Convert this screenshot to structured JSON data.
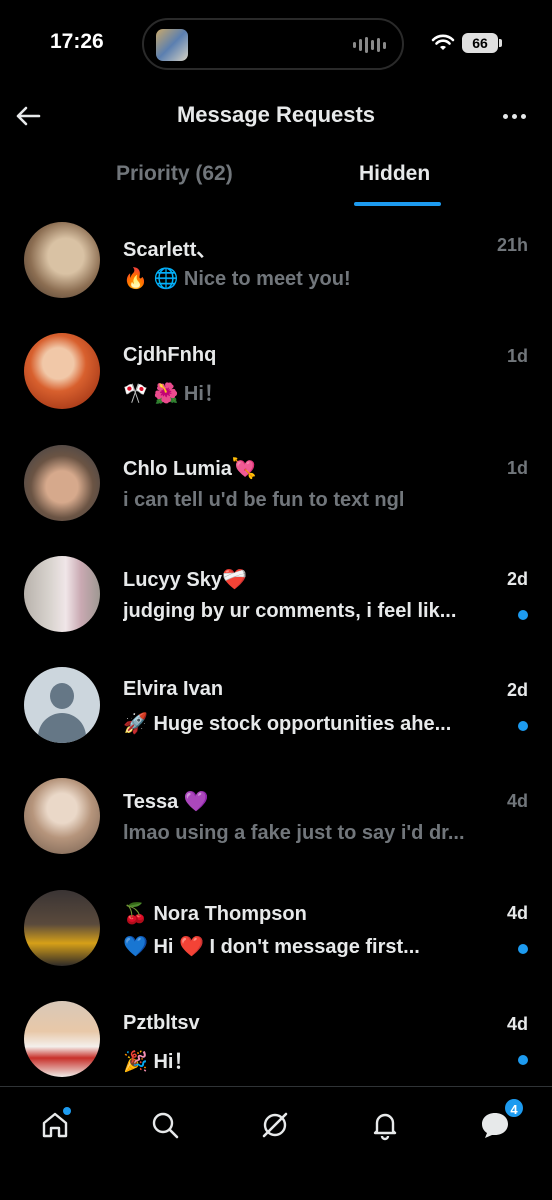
{
  "status": {
    "time": "17:26",
    "battery": "66"
  },
  "header": {
    "title": "Message Requests"
  },
  "tabs": [
    {
      "label": "Priority (62)",
      "active": false
    },
    {
      "label": "Hidden",
      "active": true
    }
  ],
  "conversations": [
    {
      "name": "Scarlett、",
      "preview": "🔥 🌐 Nice to meet you!",
      "time": "21h",
      "unread": false,
      "avatar": "photo"
    },
    {
      "name": "CjdhFnhq",
      "preview": "🎌 🌺 Hi！",
      "time": "1d",
      "unread": false,
      "avatar": "photo"
    },
    {
      "name": "Chlo Lumia💘",
      "preview": "i can tell u'd be fun to text ngl",
      "time": "1d",
      "unread": false,
      "avatar": "photo"
    },
    {
      "name": "Lucyy Sky❤️‍🩹",
      "preview": "judging by ur comments, i feel lik...",
      "time": "2d",
      "unread": true,
      "avatar": "photo"
    },
    {
      "name": "Elvira Ivan",
      "preview": "🚀 Huge stock opportunities ahe...",
      "time": "2d",
      "unread": true,
      "avatar": "default"
    },
    {
      "name": "Tessa 💜",
      "preview": "lmao using a fake just to say i'd dr...",
      "time": "4d",
      "unread": false,
      "avatar": "photo"
    },
    {
      "name": "🍒 Nora Thompson",
      "preview": "💙 Hi     ❤️ I don't message first...",
      "time": "4d",
      "unread": true,
      "avatar": "photo"
    },
    {
      "name": "Pztbltsv",
      "preview": "🎉 Hi！",
      "time": "4d",
      "unread": true,
      "avatar": "photo"
    }
  ],
  "bottom_nav": {
    "items": [
      "home-icon",
      "search-icon",
      "grok-icon",
      "notifications-icon",
      "messages-icon"
    ],
    "messages_badge": "4"
  },
  "colors": {
    "accent": "#1d9bf0",
    "background": "#000000",
    "text_primary": "#e7e9ea",
    "text_secondary": "#71767b"
  }
}
